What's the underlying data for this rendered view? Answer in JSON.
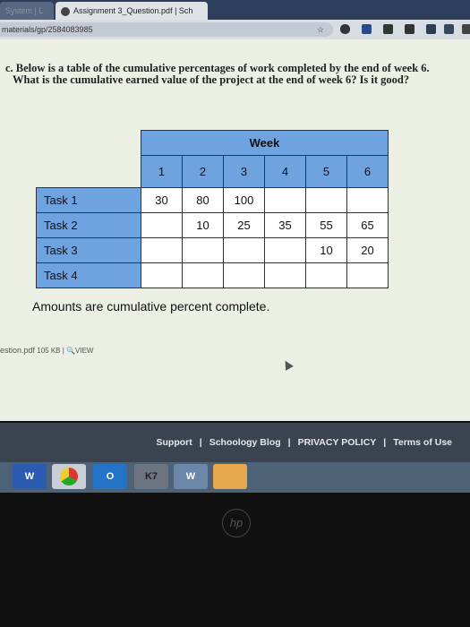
{
  "browser": {
    "tabs": [
      {
        "label": "System | L"
      },
      {
        "label": "Assignment 3_Question.pdf | Sch",
        "close": "×"
      }
    ],
    "url": "materials/gp/2584083985",
    "star": "☆"
  },
  "question": {
    "line1": "c. Below is a table of the cumulative percentages of work completed by the end of week 6.",
    "line2": "What is the cumulative earned value of the project at the end of week 6? Is it good?"
  },
  "table": {
    "header": "Week",
    "weeks": [
      "1",
      "2",
      "3",
      "4",
      "5",
      "6"
    ],
    "rows": [
      {
        "task": "Task 1",
        "values": [
          "30",
          "80",
          "100",
          "",
          "",
          ""
        ]
      },
      {
        "task": "Task 2",
        "values": [
          "",
          "10",
          "25",
          "35",
          "55",
          "65"
        ]
      },
      {
        "task": "Task 3",
        "values": [
          "",
          "",
          "",
          "",
          "10",
          "20"
        ]
      },
      {
        "task": "Task 4",
        "values": [
          "",
          "",
          "",
          "",
          "",
          ""
        ]
      }
    ],
    "note": "Amounts are cumulative percent complete."
  },
  "file": {
    "name": "estion.pdf",
    "size": "105 KB",
    "view": "VIEW"
  },
  "footer": {
    "links": [
      "Support",
      "Schoology Blog",
      "PRIVACY POLICY",
      "Terms of Use"
    ],
    "sep": "|"
  },
  "taskbar": [
    "W",
    "",
    "O",
    "K7",
    "W",
    ""
  ],
  "logo": "hp"
}
